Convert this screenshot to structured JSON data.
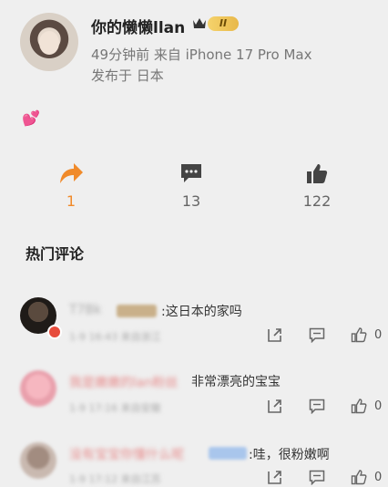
{
  "post": {
    "username": "你的懒懒llan",
    "vip_level": "II",
    "time_ago": "49分钟前",
    "source": "来自 iPhone 17 Pro Max",
    "location": "发布于 日本",
    "content": "💕"
  },
  "actions": [
    {
      "name": "share",
      "count": "1"
    },
    {
      "name": "comment",
      "count": "13"
    },
    {
      "name": "like",
      "count": "122"
    }
  ],
  "comments_section": {
    "title": "热门评论",
    "comments": [
      {
        "name": "T7Bk",
        "text": ":这日本的家吗",
        "sub": "1-9 16:43 来自浙江",
        "likes": "0"
      },
      {
        "name": "我是嫩嫩的lan粉丝",
        "text": "非常漂亮的宝宝",
        "sub": "1-9 17:16 来自安徽",
        "likes": "0"
      },
      {
        "name": "没有宝宝你懂什么呢",
        "text": ":哇，很粉嫩啊",
        "sub": "1-9 17:12 来自江苏",
        "likes": "0"
      }
    ]
  },
  "colors": {
    "accent_orange": "#f08a2a",
    "name_pink": "#e78b8b",
    "vip_gold": "#f5d36c"
  }
}
